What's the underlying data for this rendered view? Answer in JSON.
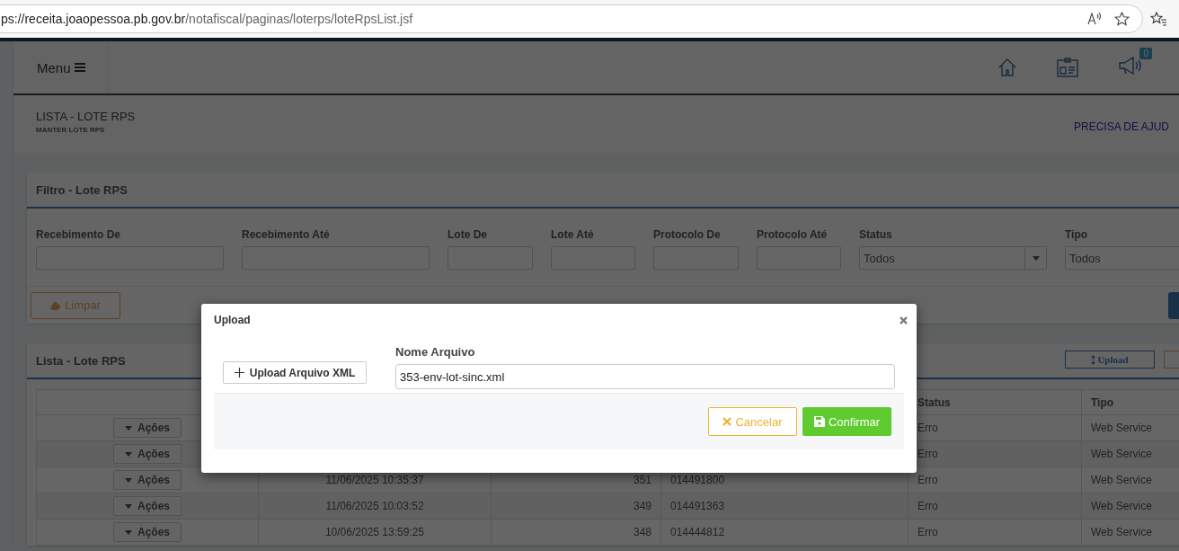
{
  "browser": {
    "url_host": "ps://receita.joaopessoa.pb.gov.br",
    "url_path": "/notafiscal/paginas/loterps/loteRpsList.jsf"
  },
  "header": {
    "menu_label": "Menu",
    "notification_count": "0"
  },
  "breadcrumb": {
    "title": "LISTA - LOTE RPS",
    "subtitle": "MANTER LOTE RPS",
    "help_link": "PRECISA DE AJUD"
  },
  "filter_panel": {
    "title": "Filtro - Lote RPS",
    "fields": [
      {
        "label": "Recebimento De",
        "kind": "text"
      },
      {
        "label": "Recebimento Até",
        "kind": "text"
      },
      {
        "label": "Lote De",
        "kind": "text"
      },
      {
        "label": "Lote Até",
        "kind": "text"
      },
      {
        "label": "Protocolo De",
        "kind": "text"
      },
      {
        "label": "Protocolo Até",
        "kind": "text"
      },
      {
        "label": "Status",
        "kind": "select",
        "value": "Todos"
      },
      {
        "label": "Tipo",
        "kind": "select_cut",
        "value": "Todos"
      }
    ],
    "clear_button": "Limpar"
  },
  "list_panel": {
    "title": "Lista - Lote RPS",
    "upload_button": "Upload",
    "columns": [
      {
        "label": "Status"
      },
      {
        "label": "Tipo"
      }
    ],
    "rows": [
      {
        "action": "Ações",
        "status": "Erro",
        "tipo": "Web Service"
      },
      {
        "action": "Ações",
        "status": "Erro",
        "tipo": "Web Service"
      },
      {
        "action": "Ações",
        "received": "11/06/2025 10:35:37",
        "lote": "351",
        "protocolo": "014491800",
        "status": "Erro",
        "tipo": "Web Service"
      },
      {
        "action": "Ações",
        "received": "11/06/2025 10:03:52",
        "lote": "349",
        "protocolo": "014491363",
        "status": "Erro",
        "tipo": "Web Service"
      },
      {
        "action": "Ações",
        "received": "10/06/2025 13:59:25",
        "lote": "348",
        "protocolo": "014444812",
        "status": "Erro",
        "tipo": "Web Service"
      }
    ]
  },
  "modal": {
    "title": "Upload",
    "upload_button": "Upload Arquivo XML",
    "field_label": "Nome Arquivo",
    "field_value": "353-env-lot-sinc.xml",
    "buttons": [
      {
        "label": "Cancelar",
        "kind": "cancel"
      },
      {
        "label": "Confirmar",
        "kind": "confirm"
      }
    ]
  }
}
